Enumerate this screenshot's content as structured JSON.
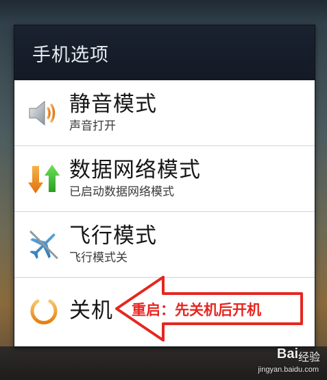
{
  "dialog": {
    "title": "手机选项"
  },
  "options": [
    {
      "label": "静音模式",
      "sublabel": "声音打开",
      "icon": "speaker-icon"
    },
    {
      "label": "数据网络模式",
      "sublabel": "已启动数据网络模式",
      "icon": "data-arrows-icon"
    },
    {
      "label": "飞行模式",
      "sublabel": "飞行模式关",
      "icon": "airplane-icon"
    },
    {
      "label": "关机",
      "icon": "power-icon"
    }
  ],
  "annotation": {
    "text": "重启：先关机后开机",
    "color": "#e6261f"
  },
  "watermark": {
    "brand": "Bai",
    "logo_text": "经验",
    "url": "jingyan.baidu.com"
  },
  "colors": {
    "header_bg": "#131a25",
    "title_text": "#e8ecf0",
    "power_orange": "#f39a1e",
    "arrow_orange": "#f08a12",
    "arrow_green": "#3bbf2f",
    "airplane_blue": "#3c8ecf"
  }
}
